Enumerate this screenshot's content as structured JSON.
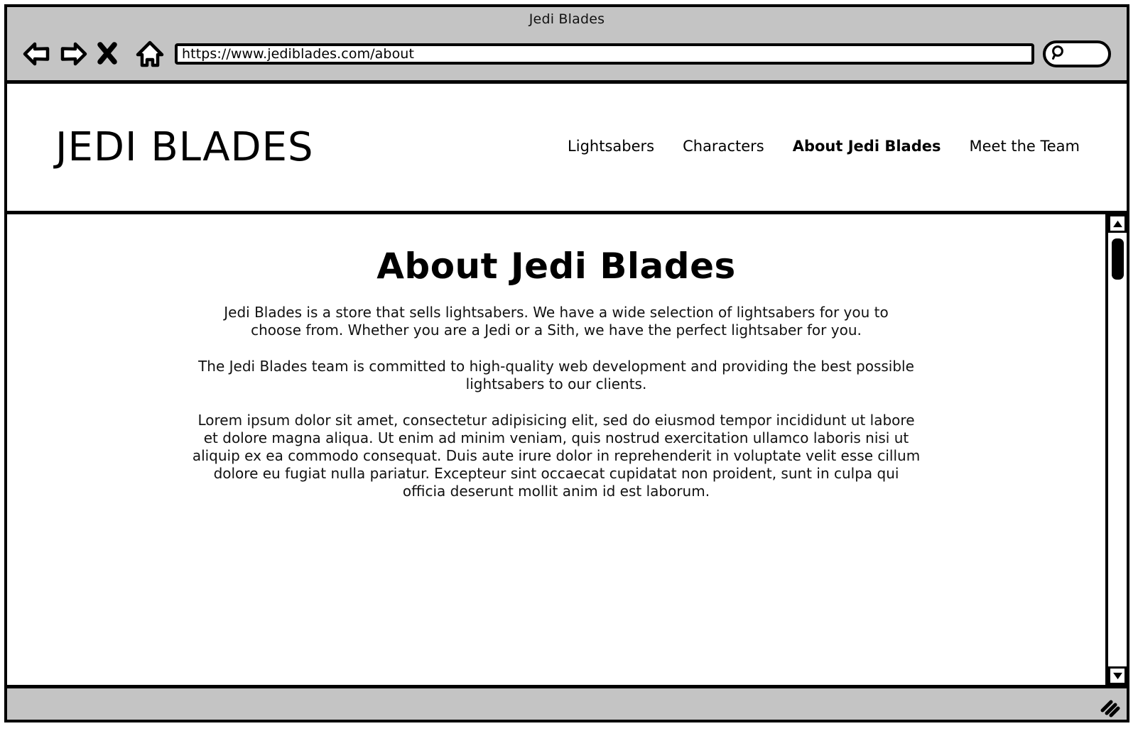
{
  "window": {
    "title": "Jedi Blades"
  },
  "toolbar": {
    "icons": [
      {
        "name": "back-icon",
        "label": "Back"
      },
      {
        "name": "forward-icon",
        "label": "Forward"
      },
      {
        "name": "stop-icon",
        "label": "Stop"
      },
      {
        "name": "home-icon",
        "label": "Home"
      }
    ],
    "url": "https://www.jediblades.com/about",
    "url_placeholder": "Enter address",
    "search_icon": "search-icon",
    "search_value": "",
    "search_placeholder": ""
  },
  "site_header": {
    "brand": "JEDI BLADES",
    "nav": [
      {
        "label": "Lightsabers",
        "active": false
      },
      {
        "label": "Characters",
        "active": false
      },
      {
        "label": "About Jedi Blades",
        "active": true
      },
      {
        "label": "Meet the Team",
        "active": false
      }
    ]
  },
  "main": {
    "heading": "About Jedi Blades",
    "paragraphs": [
      "Jedi Blades is a store that sells lightsabers. We have a wide selection of lightsabers for you to choose from. Whether you are a Jedi or a Sith, we have the perfect lightsaber for you.",
      "The Jedi Blades team is committed to high-quality web development and providing the best possible lightsabers to our clients.",
      "Lorem ipsum dolor sit amet, consectetur adipisicing elit, sed do eiusmod tempor incididunt ut labore et dolore magna aliqua. Ut enim ad minim veniam, quis nostrud exercitation ullamco laboris nisi ut aliquip ex ea commodo consequat. Duis aute irure dolor in reprehenderit in voluptate velit esse cillum dolore eu fugiat nulla pariatur. Excepteur sint occaecat cupidatat non proident, sunt in culpa qui officia deserunt mollit anim id est laborum."
    ]
  },
  "scrollbar": {
    "up_icon": "triangle-up-icon",
    "down_icon": "triangle-down-icon",
    "thumb": "scroll-thumb"
  },
  "status_bar": {
    "text": "",
    "resize_icon": "resize-grip-icon"
  },
  "colors": {
    "chrome": "#c4c4c4",
    "ink": "#000000",
    "page": "#ffffff"
  }
}
